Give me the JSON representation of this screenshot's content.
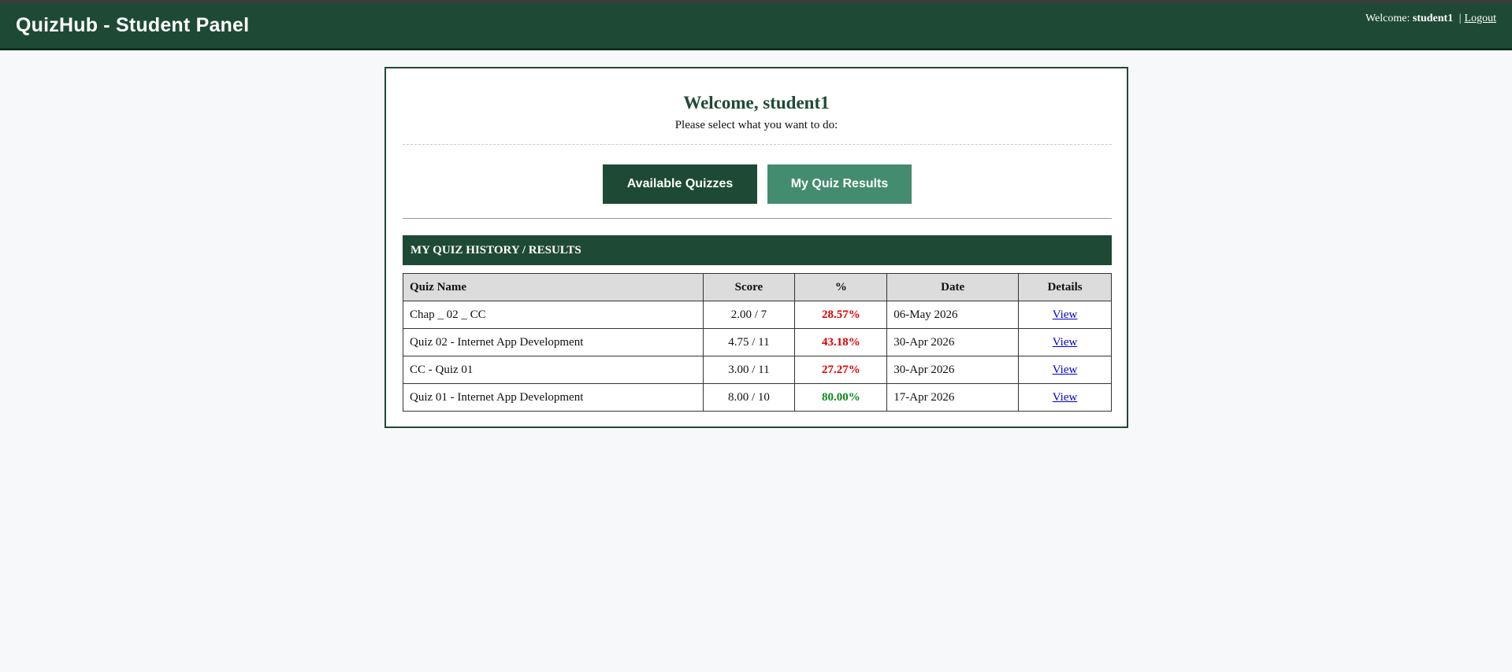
{
  "header": {
    "brand": "QuizHub - Student Panel",
    "welcome_prefix": "Welcome:",
    "username": "student1",
    "separator": "|",
    "logout_label": "Logout"
  },
  "main": {
    "welcome_title": "Welcome, student1",
    "subtitle": "Please select what you want to do:",
    "buttons": {
      "available_quizzes": "Available Quizzes",
      "my_quiz_results": "My Quiz Results"
    },
    "section_title": "MY QUIZ HISTORY / RESULTS",
    "table": {
      "headers": [
        "Quiz Name",
        "Score",
        "%",
        "Date",
        "Details"
      ],
      "rows": [
        {
          "name": "Chap _ 02 _ CC",
          "score": "2.00 / 7",
          "percent": "28.57%",
          "status": "low",
          "date": "06-May 2026",
          "details": "View"
        },
        {
          "name": "Quiz 02 - Internet App Development",
          "score": "4.75 / 11",
          "percent": "43.18%",
          "status": "low",
          "date": "30-Apr 2026",
          "details": "View"
        },
        {
          "name": "CC - Quiz 01",
          "score": "3.00 / 11",
          "percent": "27.27%",
          "status": "low",
          "date": "30-Apr 2026",
          "details": "View"
        },
        {
          "name": "Quiz 01 - Internet App Development",
          "score": "8.00 / 10",
          "percent": "80.00%",
          "status": "good",
          "date": "17-Apr 2026",
          "details": "View"
        }
      ]
    }
  },
  "colors": {
    "brand_green": "#1e4a35",
    "accent_green": "#448c6f",
    "fail_red": "#e00000",
    "pass_green": "#0a8a1a",
    "link_blue": "#0000cc"
  }
}
